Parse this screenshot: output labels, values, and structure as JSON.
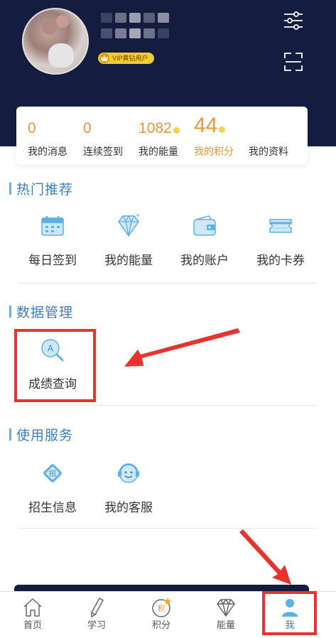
{
  "header": {
    "vip_label": "VIP黄钻用户"
  },
  "stats": [
    {
      "value": "0",
      "label": "我的消息"
    },
    {
      "value": "0",
      "label": "连续签到"
    },
    {
      "value": "1082",
      "label": "我的能量"
    },
    {
      "value": "44",
      "label": "我的积分"
    },
    {
      "value": "",
      "label": "我的资料"
    }
  ],
  "sections": {
    "hot": {
      "title": "热门推荐",
      "items": [
        {
          "label": "每日签到",
          "icon": "calendar-icon"
        },
        {
          "label": "我的能量",
          "icon": "diamond-icon"
        },
        {
          "label": "我的账户",
          "icon": "wallet-icon"
        },
        {
          "label": "我的卡券",
          "icon": "ticket-icon"
        }
      ]
    },
    "data": {
      "title": "数据管理",
      "items": [
        {
          "label": "成绩查询",
          "icon": "search-icon"
        }
      ]
    },
    "service": {
      "title": "使用服务",
      "items": [
        {
          "label": "招生信息",
          "icon": "enroll-icon"
        },
        {
          "label": "我的客服",
          "icon": "customer-service-icon"
        }
      ]
    }
  },
  "tabbar": [
    {
      "label": "首页",
      "icon": "home-icon"
    },
    {
      "label": "学习",
      "icon": "pencil-icon"
    },
    {
      "label": "积分",
      "icon": "points-icon",
      "icon_text": "积"
    },
    {
      "label": "能量",
      "icon": "diamond-icon"
    },
    {
      "label": "我",
      "icon": "user-icon",
      "active": true
    }
  ],
  "colors": {
    "header_bg": "#141c40",
    "accent_orange": "#e8963b",
    "accent_blue": "#3c7fc0",
    "icon_blue": "#5fb0e8",
    "annotation_red": "#e8322c"
  }
}
